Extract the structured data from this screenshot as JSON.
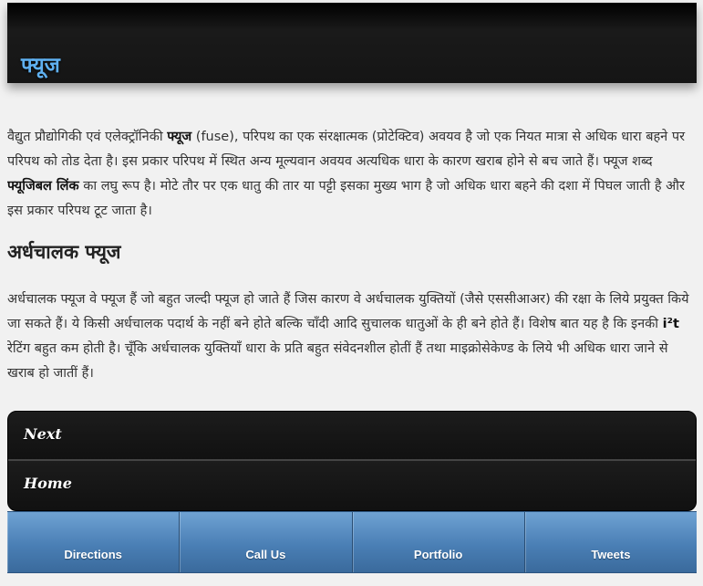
{
  "header": {
    "title": "फ्यूज"
  },
  "intro": {
    "part1": "वैद्युत प्रौद्योगिकी एवं एलेक्ट्रॉनिकी ",
    "term": "फ्यूज",
    "part2": " (fuse), परिपथ का एक संरक्षात्मक (प्रोटेक्टिव) अवयव है जो एक नियत मात्रा से अधिक धारा बहने पर परिपथ को तोड देता है। इस प्रकार परिपथ में स्थित अन्य मूल्यवान अवयव अत्यधिक धारा के कारण खराब होने से बच जाते हैं। फ्यूज शब्द ",
    "term2": "फ्यूजिबल लिंक",
    "part3": " का लघु रूप है। मोटे तौर पर एक धातु की तार या पट्टी इसका मुख्य भाग है जो अधिक धारा बहने की दशा में पिघल जाती है और इस प्रकार परिपथ टूट जाता है।"
  },
  "section": {
    "heading": "अर्धचालक फ्यूज",
    "part1": "अर्धचालक फ्यूज वे फ्यूज हैं जो बहुत जल्दी फ्यूज हो जाते हैं जिस कारण वे अर्धचालक युक्तियों (जैसे एससीआअर) की रक्षा के लिये प्रयुक्त किये जा सकते हैं। ये किसी अर्धचालक पदार्थ के नहीं बने होते बल्कि चाँदी आदि सुचालक धातुओं के ही बने होते हैं। विशेष बात यह है कि इनकी ",
    "rating_term": "i²t",
    "part2": " रेटिंग बहुत कम होती है। चूँकि अर्धचालक युक्तियाँ धारा के प्रति बहुत संवेदनशील होतीं हैं तथा माइक्रोसेकेण्ड के लिये भी अधिक धारा जाने से खराब हो जातीं हैं।"
  },
  "nav": {
    "items": [
      {
        "label": "Next"
      },
      {
        "label": "Home"
      }
    ]
  },
  "footer": {
    "buttons": [
      {
        "label": "Directions"
      },
      {
        "label": "Call Us"
      },
      {
        "label": "Portfolio"
      },
      {
        "label": "Tweets"
      }
    ]
  },
  "colors": {
    "header_bg": "#151515",
    "title_blue": "#5fb0f0",
    "footer_blue": "#4a7fb5",
    "page_bg": "#f1f1f1"
  }
}
